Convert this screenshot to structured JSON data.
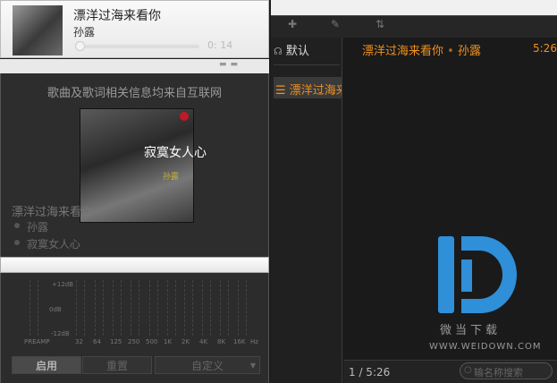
{
  "mini_player": {
    "song_title": "漂洋过海来看你",
    "artist": "孙露",
    "time": "0: 14"
  },
  "lyrics_panel": {
    "notice": "歌曲及歌词相关信息均来自互联网",
    "cover_title": "寂寞女人心",
    "cover_tag": "孙露",
    "song": "漂洋过海来看你",
    "artist": "孙露",
    "album": "寂寞女人心"
  },
  "equalizer": {
    "db_top": "+12dB",
    "db_mid": "0dB",
    "db_bottom": "-12dB",
    "bands": [
      "PREAMP",
      "32",
      "64",
      "125",
      "250",
      "500",
      "1K",
      "2K",
      "4K",
      "8K",
      "16K",
      "Hz"
    ],
    "enable_label": "启用",
    "reset_label": "重置",
    "custom_label": "自定义"
  },
  "toolbar": {
    "add_icon": "plus-icon",
    "edit_icon": "pencil-icon",
    "sort_icon": "sort-icon"
  },
  "playlists": {
    "default_label": "默认",
    "current_label": "漂洋过海来看你"
  },
  "track_list": [
    {
      "title": "漂洋过海来看你",
      "artist": "孙露",
      "duration": "5:26"
    }
  ],
  "status_bar": {
    "count": "1 / 5:26",
    "search_placeholder": "输名称搜索"
  },
  "watermark": {
    "brand": "微当下载",
    "url": "WWW.WEIDOWN.COM"
  },
  "colors": {
    "accent": "#f09020",
    "logo_blue": "#2f8fd8"
  }
}
